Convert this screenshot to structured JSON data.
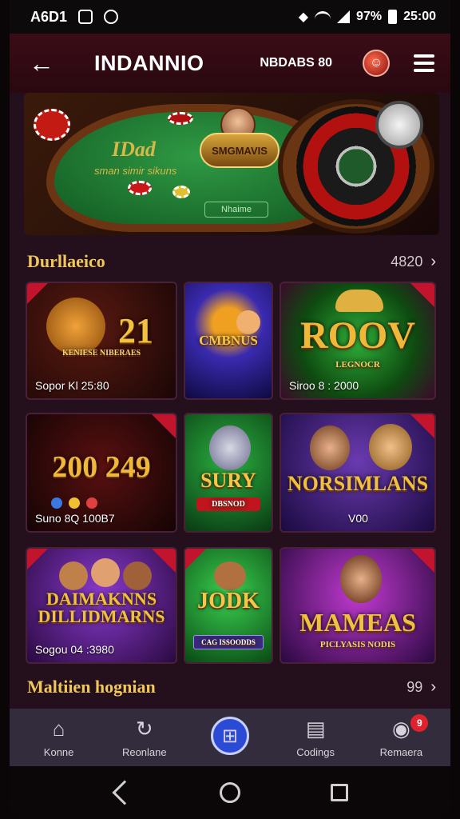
{
  "status_bar": {
    "carrier": "A6D1",
    "battery_pct": "97%",
    "time": "25:00"
  },
  "header": {
    "title": "INDANNIO",
    "balance_label": "NBDABS 80"
  },
  "hero": {
    "felt_title": "IDad",
    "felt_subtitle": "sman simir sikuns",
    "dealer_badge": "SMGMAVIS",
    "felt_box": "Nhaime"
  },
  "section1": {
    "title": "Durllaeico",
    "more_count": "4820"
  },
  "section2": {
    "title": "Maltiien hognian",
    "more_count": "99"
  },
  "games": [
    {
      "logo": "21",
      "sub": "KENIESE NIBERAES",
      "meta": "Sopor Kl 25:80"
    },
    {
      "logo": "CMBNUS",
      "sub": "",
      "meta": ""
    },
    {
      "logo": "ROOV",
      "sub": "LEGNOCR",
      "meta": "Siroo 8 : 2000"
    },
    {
      "logo": "200 249",
      "sub": "",
      "meta": "Suno 8Q 100B7"
    },
    {
      "logo": "SURY",
      "sub": "DBSNOD",
      "meta": ""
    },
    {
      "logo": "NORSIMLANS",
      "sub": "",
      "meta": "V00"
    },
    {
      "logo": "DAIMAKNNS DILLIDMARNS",
      "sub": "",
      "meta": "Sogou 04 :3980"
    },
    {
      "logo": "JODK",
      "sub": "CAG ISSOODDS",
      "meta": ""
    },
    {
      "logo": "MAMEAS",
      "sub": "PICLYASIS NODIS",
      "meta": ""
    }
  ],
  "bottom_nav": [
    {
      "label": "Konne",
      "icon": "home-icon"
    },
    {
      "label": "Reonlane",
      "icon": "refresh-icon"
    },
    {
      "label": "",
      "icon": "gift-icon"
    },
    {
      "label": "Codings",
      "icon": "wallet-icon"
    },
    {
      "label": "Remaera",
      "icon": "profile-icon",
      "badge": "9"
    }
  ],
  "colors": {
    "accent_gold": "#f0c85a",
    "header_bg": "#3a0c16",
    "nav_bg": "#332c3c",
    "primary_blue": "#2b4ad6",
    "badge_red": "#e0222c"
  }
}
